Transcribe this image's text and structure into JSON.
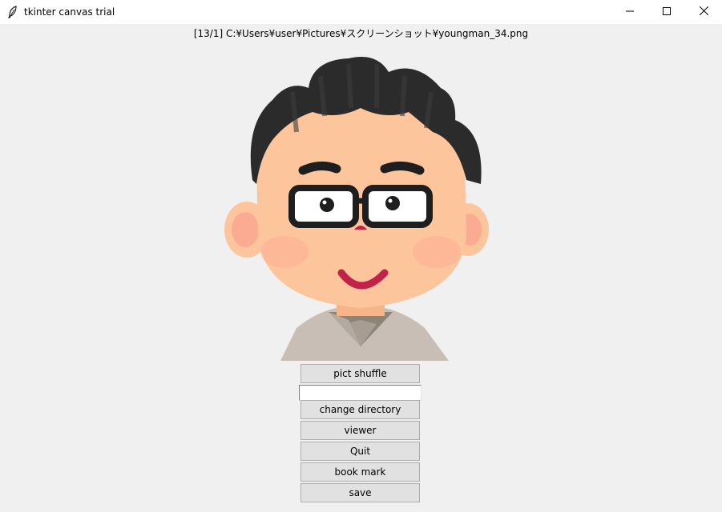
{
  "window": {
    "title": "tkinter canvas trial",
    "icon": "feather-icon",
    "controls": [
      "minimize-icon",
      "maximize-icon",
      "close-icon"
    ]
  },
  "path_label": "[13/1] C:¥Users¥user¥Pictures¥スクリーンショット¥youngman_34.png",
  "image": {
    "subject": "illustration of a young man with glasses",
    "colors": {
      "hair": "#2b2b2b",
      "skin": "#fdc59b",
      "cheek": "#f9a08e",
      "mouth": "#c0224a",
      "shirt": "#c9beb6"
    }
  },
  "controls": {
    "shuffle_label": "pict shuffle",
    "entry_value": "",
    "change_dir_label": "change directory",
    "viewer_label": "viewer",
    "quit_label": "Quit",
    "bookmark_label": "book mark",
    "save_label": "save"
  }
}
